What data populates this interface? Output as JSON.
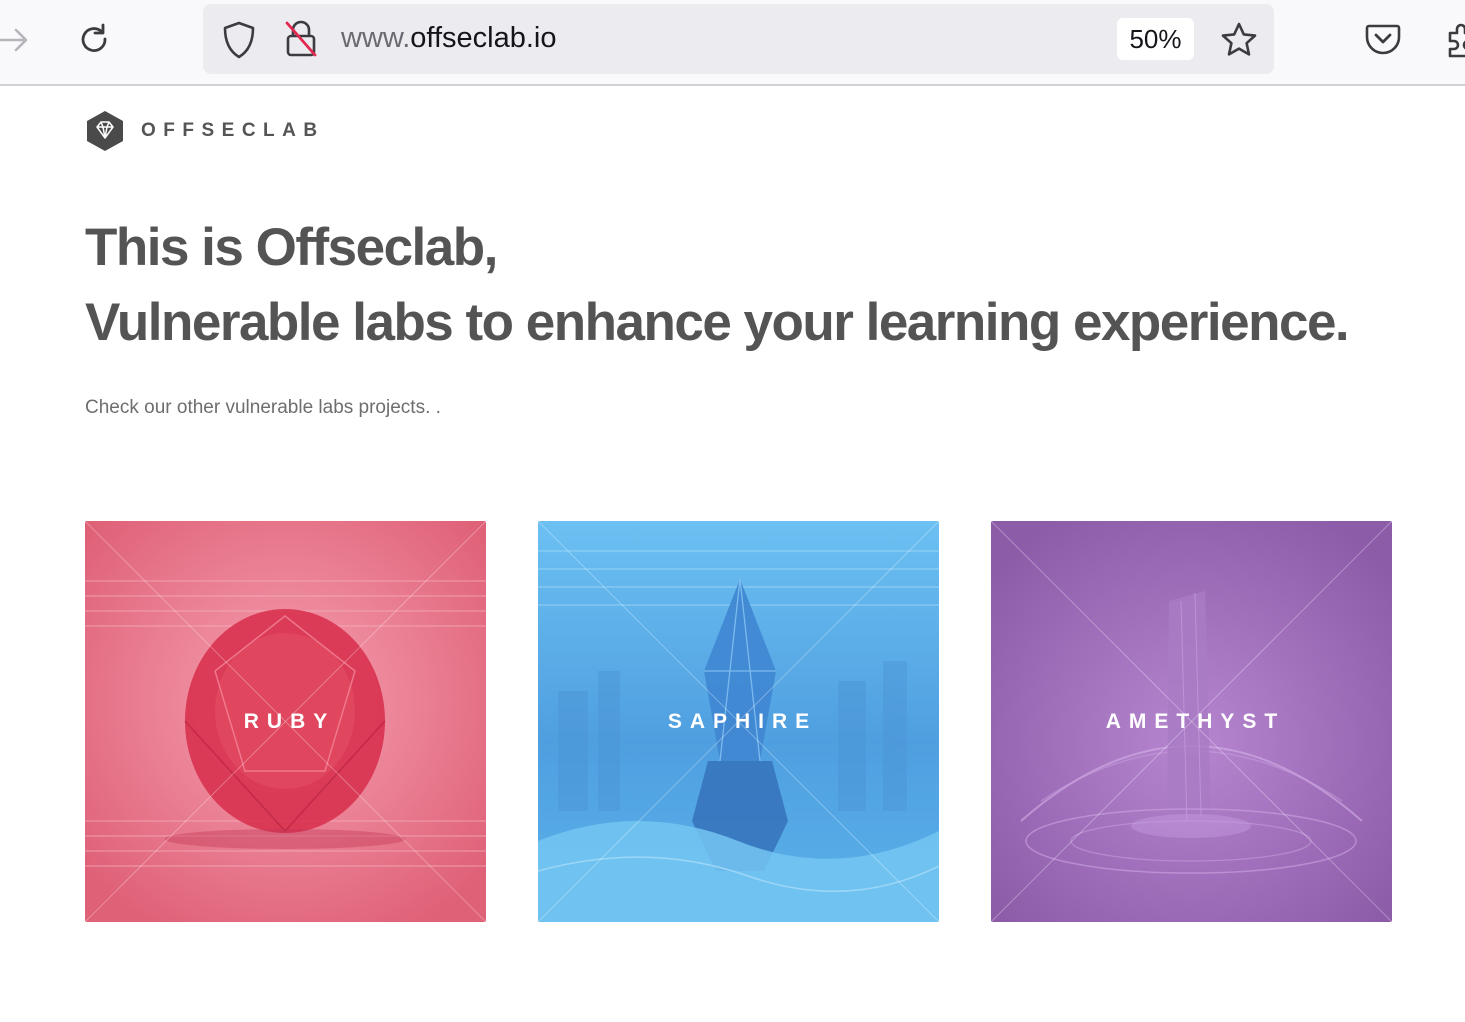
{
  "browser": {
    "url_prefix": "www.",
    "url_domain": "offseclab.io",
    "zoom": "50%",
    "icons": [
      "forward-arrow-icon",
      "reload-icon",
      "shield-icon",
      "insecure-lock-icon",
      "bookmark-star-icon",
      "pocket-icon",
      "extensions-icon"
    ]
  },
  "site": {
    "brand_name": "OFFSECLAB",
    "hero_line1": "This is Offseclab,",
    "hero_line2": "Vulnerable labs to enhance your learning experience.",
    "subtitle": "Check our other vulnerable labs projects. .",
    "cards": [
      {
        "label": "RUBY",
        "color": "#e46f86"
      },
      {
        "label": "SAPHIRE",
        "color": "#5aaee8"
      },
      {
        "label": "AMETHYST",
        "color": "#9666b0"
      }
    ]
  },
  "colors": {
    "heading": "#545454",
    "text": "#6e6e6e",
    "toolbar_bg": "#f9f9fb",
    "urlbar_bg": "#ececf0"
  }
}
